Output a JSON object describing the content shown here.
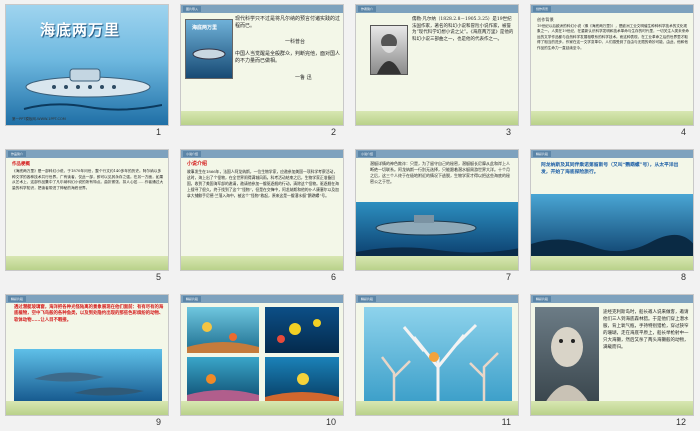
{
  "slides": [
    {
      "num": "1",
      "title": "海底两万里",
      "footer": "第一PPT模板网-WWW.1PPT.COM"
    },
    {
      "num": "2",
      "tag": "图片导入",
      "quote1": "现代科学只不过是将凡尔纳的预言付诸实践的过程而已。",
      "author1": "一科普台",
      "quote2": "中国人当觉醒是全般群众，判断完他，面对国人的不力量而已做相。",
      "author2": "一鲁  迅"
    },
    {
      "num": "3",
      "tag": "作者简介",
      "bio": "儒勒·凡尔纳（1828.2.8－1905.3.25）是19世纪法国作家，著名的科幻小说和冒险小说作家，被誉为“现代科学幻想小说之父”。《海底两万里》是他的科幻小说三部曲之一，也是他的代表作之一。"
    },
    {
      "num": "4",
      "tag": "创作背景",
      "body": "19世纪以后欧洲的科幻小说（像《海底两万里》），是欧洲工业文明催生种种科学技术的文化现象之一。人类在19世纪，在重新认识科学发明和技术革命与生存的时代里，一切关注人类未来命运的文学作品都与自然科学发展相联系的科学技术。而这种表现，在工业革命之后的世界里才取得了相当的进步。作家在这一文学变革中，人们感受到了自由与无限的奇妙可能，由此，他和他作品的生命力一直延续至今。"
    },
    {
      "num": "5",
      "tag": "作品简介",
      "heading": "作品梗概",
      "body": "《海底两万里》是一部科幻小说，于1870年问世，整个行文约140多年的历史。阿尔纳以多种文学的各种技术共行世界。广有读者，仅此一部，即可以见其永存之强。在另一方面，如果从艺术上，这部作品集中了凡尔纳科幻小说的所有特点。曲折紧张，扣人心弦……作者通过大量的科学知识，把读者带进了神秘的海底世界。"
    },
    {
      "num": "6",
      "tag": "小说介绍",
      "heading": "小说介绍",
      "body": "故事发生在1866年，法国人阿龙纳斯，一位生物学家，应邀参加美国一项科学考察活动，这时，海上出了个怪物，在全世界闹得满城风雨。科考活动结束之后，生物学家正准备回国，收到了美国海军部的邀请，邀请他参加一艘驱逐舰的行动，清除这个怪物。驱逐舰在海上搜寻了很久，终于找到了这个“怪物”，但是在交锋中，阿龙纳斯和他的仆人康塞尔以及加拿大捕鲸手尼德·兰落入海中，被这个“怪物”救起，原来这是一艘潜水艇“鹦鹉螺”号。"
    },
    {
      "num": "7",
      "tag": "小说介绍",
      "body": "潜艇详情的神色欺诈：只是，为了留守自己的秘密，潜艇艇长尼摩从此和岸上人断绝一切联系。阿龙纳斯一行别无选择，只能跟着潜水艇周游世界大洋。十个月之后，这三个人终于在极地附近的情况下逃脱，生物学家才得以把这些海底的秘密公之于世。"
    },
    {
      "num": "8",
      "tag": "精彩片段",
      "body": "阿龙纳斯及其同伴乘诺第留斯号（又叫“鹦鹉螺”号），从太平洋出发，开始了海底探险旅行。"
    },
    {
      "num": "9",
      "tag": "精彩片段",
      "body": "透过潜艇玻璃窗，海洋把各种光怪陆离的景象展现在他们面前：有有尽有的海底植物，空中飞鸟般的各种鱼类，以及到处隐约出现的那些色彩缤纷的动物、软体动物……让人目不暇接。"
    },
    {
      "num": "10",
      "tag": "精彩片段"
    },
    {
      "num": "11",
      "tag": "精彩片段"
    },
    {
      "num": "12",
      "tag": "精彩片段",
      "body": "途经克利斯岛时，船长邀人说来做客，邀请他们三人到海底森林猎。于是他们穿上潜水服，背上氧气瓶，手持特别猎枪，穿过狭窄的珊瑚，走在海底平原上，船长举枪射中一只大海獭，然后又杀了两头海獭般的动物，满载而归。"
    }
  ]
}
